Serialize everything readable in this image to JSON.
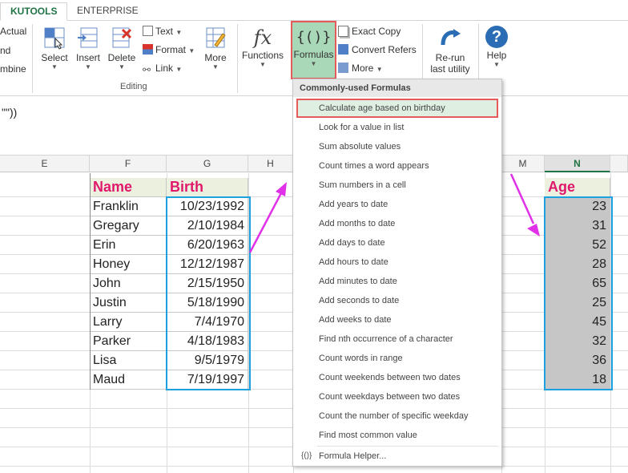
{
  "tabs": {
    "kutools": "KUTOOLS",
    "enterprise": "ENTERPRISE"
  },
  "ribbon": {
    "left_labels": [
      "Actual",
      "nd",
      "mbine"
    ],
    "editing": {
      "select": "Select",
      "insert": "Insert",
      "delete": "Delete",
      "text": "Text",
      "format": "Format",
      "link": "Link",
      "more": "More",
      "group": "Editing"
    },
    "functions": "Functions",
    "formulas": "Formulas",
    "exact_copy": "Exact Copy",
    "convert_refers": "Convert Refers",
    "more": "More",
    "rerun_line1": "Re-run",
    "rerun_line2": "last utility",
    "help": "Help"
  },
  "formula_bar": {
    "text": "\"\"))"
  },
  "columns": {
    "e": "E",
    "f": "F",
    "g": "G",
    "h": "H",
    "m": "M",
    "n": "N"
  },
  "table": {
    "name_header": "Name",
    "birth_header": "Birth",
    "age_header": "Age",
    "rows": [
      {
        "name": "Franklin",
        "birth": "10/23/1992",
        "age": "23"
      },
      {
        "name": "Gregary",
        "birth": "2/10/1984",
        "age": "31"
      },
      {
        "name": "Erin",
        "birth": "6/20/1963",
        "age": "52"
      },
      {
        "name": "Honey",
        "birth": "12/12/1987",
        "age": "28"
      },
      {
        "name": "John",
        "birth": "2/15/1950",
        "age": "65"
      },
      {
        "name": "Justin",
        "birth": "5/18/1990",
        "age": "25"
      },
      {
        "name": "Larry",
        "birth": "7/4/1970",
        "age": "45"
      },
      {
        "name": "Parker",
        "birth": "4/18/1983",
        "age": "32"
      },
      {
        "name": "Lisa",
        "birth": "9/5/1979",
        "age": "36"
      },
      {
        "name": "Maud",
        "birth": "7/19/1997",
        "age": "18"
      }
    ]
  },
  "dropdown": {
    "header": "Commonly-used Formulas",
    "items": [
      "Calculate age based on birthday",
      "Look for a value in list",
      "Sum absolute values",
      "Count times a word appears",
      "Sum numbers in a cell",
      "Add years to date",
      "Add months to date",
      "Add days to date",
      "Add hours to date",
      "Add minutes to date",
      "Add seconds to date",
      "Add weeks to date",
      "Find nth occurrence of a character",
      "Count words in range",
      "Count weekends between two dates",
      "Count weekdays between two dates",
      "Count the number of specific weekday",
      "Find most common value"
    ],
    "helper": "Formula Helper...",
    "helper_icon_glyph": "{()}"
  },
  "colors": {
    "accent": "#217346",
    "highlight_border": "#e55a5a",
    "header_text": "#e0186c",
    "selection_border": "#1ba0e2",
    "arrow": "#e030e8"
  }
}
